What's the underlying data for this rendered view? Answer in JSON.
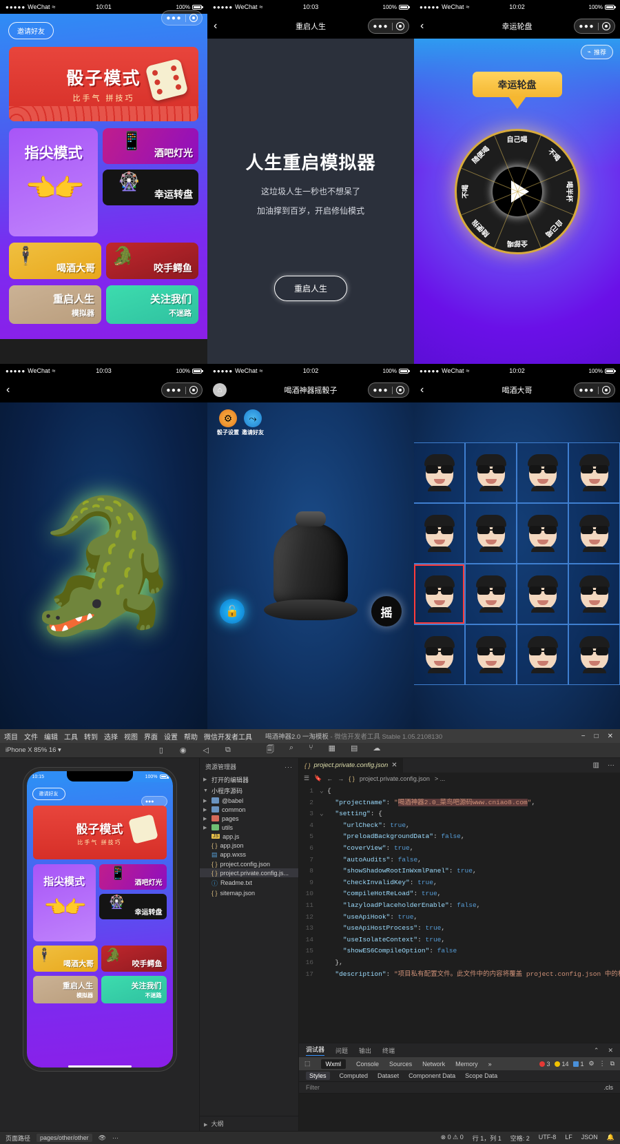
{
  "phones": {
    "p1": {
      "status": {
        "carrier": "WeChat",
        "dots": "●●●●●",
        "wifi": "≈",
        "time": "10:01",
        "battery": "100%"
      },
      "invite_label": "邀请好友",
      "banner": {
        "title": "骰子模式",
        "subtitle": "比手气  拼技巧"
      },
      "tip_card": {
        "title": "指尖模式"
      },
      "bar_light": "酒吧灯光",
      "lucky_wheel": "幸运转盘",
      "drink_boss": "喝酒大哥",
      "bite_croc": "咬手鳄鱼",
      "restart_life": {
        "title": "重启人生",
        "sub": "模拟器"
      },
      "follow_us": {
        "title": "关注我们",
        "sub": "不迷路"
      }
    },
    "p2": {
      "status": {
        "carrier": "WeChat",
        "dots": "●●●●●",
        "wifi": "≈",
        "time": "10:03",
        "battery": "100%"
      },
      "nav_title": "重启人生",
      "heading": "人生重启模拟器",
      "sub1": "这垃圾人生一秒也不想呆了",
      "sub2": "加油撑到百岁，开启修仙模式",
      "button": "重启人生"
    },
    "p3": {
      "status": {
        "carrier": "WeChat",
        "dots": "●●●●●",
        "wifi": "≈",
        "time": "10:02",
        "battery": "100%"
      },
      "nav_title": "幸运轮盘",
      "recommend": "推荐",
      "banner": "幸运轮盘",
      "wheel_segments": [
        "自己喝",
        "不喝",
        "喝半杯",
        "自己喝",
        "全部喝",
        "随便指",
        "不喝",
        "随便喝"
      ]
    },
    "p4": {
      "status": {
        "carrier": "WeChat",
        "dots": "●●●●●",
        "wifi": "≈",
        "time": "10:03",
        "battery": "100%"
      },
      "nav_title": ""
    },
    "p5": {
      "status": {
        "carrier": "WeChat",
        "dots": "●●●●●",
        "wifi": "≈",
        "time": "10:02",
        "battery": "100%"
      },
      "nav_title": "喝酒神器摇骰子",
      "tool1": "骰子设置",
      "tool2": "邀请好友",
      "shake_label": "摇"
    },
    "p6": {
      "status": {
        "carrier": "WeChat",
        "dots": "●●●●●",
        "wifi": "≈",
        "time": "10:02",
        "battery": "100%"
      },
      "nav_title": "喝酒大哥"
    }
  },
  "ide": {
    "menus": [
      "项目",
      "文件",
      "编辑",
      "工具",
      "转到",
      "选择",
      "视图",
      "界面",
      "设置",
      "帮助",
      "微信开发者工具"
    ],
    "title": "喝酒神器2.0 一淘模板",
    "title_dim": "微信开发者工具 Stable 1.05.2108130",
    "window_controls": [
      "−",
      "□",
      "✕"
    ],
    "simulator_select": "iPhone X 85% 16 ▾",
    "explorer": {
      "header": "资源管理器",
      "header_dots": "···",
      "open_editors": "打开的编辑器",
      "project_root": "小程序源码",
      "items": [
        {
          "name": "@babel",
          "type": "folder",
          "color": "blue"
        },
        {
          "name": "common",
          "type": "folder",
          "color": "blue"
        },
        {
          "name": "pages",
          "type": "folder",
          "color": "red"
        },
        {
          "name": "utils",
          "type": "folder",
          "color": "green"
        },
        {
          "name": "app.js",
          "type": "js"
        },
        {
          "name": "app.json",
          "type": "json"
        },
        {
          "name": "app.wxss",
          "type": "wxss"
        },
        {
          "name": "project.config.json",
          "type": "json"
        },
        {
          "name": "project.private.config.js...",
          "type": "json",
          "selected": true
        },
        {
          "name": "Readme.txt",
          "type": "txt"
        },
        {
          "name": "sitemap.json",
          "type": "json"
        }
      ],
      "footer": "大纲"
    },
    "editor": {
      "tab_label": "project.private.config.json",
      "tab_close": "✕",
      "breadcrumb_file": "project.private.config.json",
      "breadcrumb_rest": "> ...",
      "lines": [
        {
          "n": "1",
          "text": "{"
        },
        {
          "n": "2",
          "text": "  \"projectname\": \"喝酒神器2.0_菜鸟吧源码www.cniao8.com\","
        },
        {
          "n": "3",
          "text": "  \"setting\": {"
        },
        {
          "n": "4",
          "text": "    \"urlCheck\": true,"
        },
        {
          "n": "5",
          "text": "    \"preloadBackgroundData\": false,"
        },
        {
          "n": "6",
          "text": "    \"coverView\": true,"
        },
        {
          "n": "7",
          "text": "    \"autoAudits\": false,"
        },
        {
          "n": "8",
          "text": "    \"showShadowRootInWxmlPanel\": true,"
        },
        {
          "n": "9",
          "text": "    \"checkInvalidKey\": true,"
        },
        {
          "n": "10",
          "text": "    \"compileHotReLoad\": true,"
        },
        {
          "n": "11",
          "text": "    \"lazyloadPlaceholderEnable\": false,"
        },
        {
          "n": "12",
          "text": "    \"useApiHook\": true,"
        },
        {
          "n": "13",
          "text": "    \"useApiHostProcess\": true,"
        },
        {
          "n": "14",
          "text": "    \"useIsolateContext\": true,"
        },
        {
          "n": "15",
          "text": "    \"showES6CompileOption\": false"
        },
        {
          "n": "16",
          "text": "  },"
        },
        {
          "n": "17",
          "text": "  \"description\": \"项目私有配置文件。此文件中的内容将覆盖 project.config.json 中的相同字"
        }
      ]
    },
    "debug": {
      "tabs": [
        "调试器",
        "问题",
        "输出",
        "终端"
      ],
      "active_tab": "调试器",
      "devtools_tabs": [
        "Wxml",
        "Console",
        "Sources",
        "Network",
        "Memory",
        "»"
      ],
      "active_devtool": "Wxml",
      "errors": "3",
      "warnings": "14",
      "infos": "1",
      "style_tabs": [
        "Styles",
        "Computed",
        "Dataset",
        "Component Data",
        "Scope Data"
      ],
      "active_style_tab": "Styles",
      "filter_placeholder": "Filter",
      "cls_label": ".cls"
    },
    "statusbar": {
      "path_label": "页面路径",
      "path_value": "pages/other/other",
      "errors": "0",
      "warnings": "0",
      "cursor": "行 1，列 1",
      "spaces": "空格: 2",
      "encoding": "UTF-8",
      "eol": "LF",
      "lang": "JSON",
      "bell": "🔔"
    }
  },
  "colors": {
    "accent_blue": "#3794ff",
    "red": "#e8453c",
    "purple": "#8b1fe8",
    "gold": "#f5b731"
  }
}
